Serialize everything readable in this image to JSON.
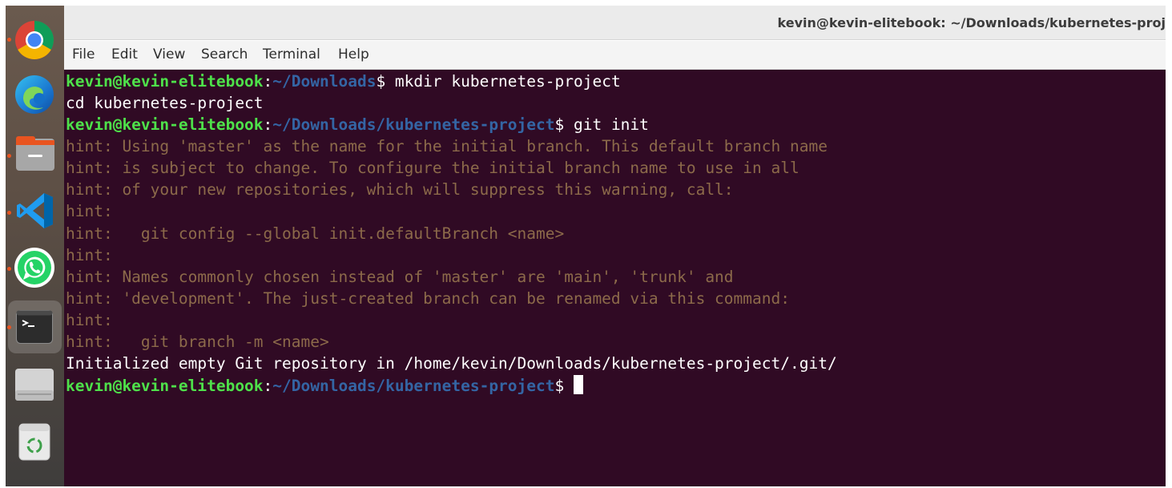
{
  "window": {
    "title": "kevin@kevin-elitebook: ~/Downloads/kubernetes-proj"
  },
  "menu": [
    "File",
    "Edit",
    "View",
    "Search",
    "Terminal",
    "Help"
  ],
  "dock": [
    {
      "name": "chrome",
      "running": true
    },
    {
      "name": "edge",
      "running": false
    },
    {
      "name": "files",
      "running": true
    },
    {
      "name": "vscode",
      "running": true
    },
    {
      "name": "whatsapp",
      "running": true
    },
    {
      "name": "terminal",
      "running": true,
      "active": true
    },
    {
      "name": "drive",
      "running": false
    },
    {
      "name": "trash",
      "running": false
    }
  ],
  "prompt": {
    "user_host": "kevin@kevin-elitebook",
    "colon": ":",
    "dollar": "$ "
  },
  "lines": [
    {
      "type": "prompt",
      "path": "~/Downloads",
      "cmd": "mkdir kubernetes-project"
    },
    {
      "type": "output",
      "text": "cd kubernetes-project"
    },
    {
      "type": "prompt",
      "path": "~/Downloads/kubernetes-project",
      "cmd": "git init"
    },
    {
      "type": "hint",
      "text": "hint: Using 'master' as the name for the initial branch. This default branch name"
    },
    {
      "type": "hint",
      "text": "hint: is subject to change. To configure the initial branch name to use in all"
    },
    {
      "type": "hint",
      "text": "hint: of your new repositories, which will suppress this warning, call:"
    },
    {
      "type": "hint",
      "text": "hint:"
    },
    {
      "type": "hint",
      "text": "hint:   git config --global init.defaultBranch <name>"
    },
    {
      "type": "hint",
      "text": "hint:"
    },
    {
      "type": "hint",
      "text": "hint: Names commonly chosen instead of 'master' are 'main', 'trunk' and"
    },
    {
      "type": "hint",
      "text": "hint: 'development'. The just-created branch can be renamed via this command:"
    },
    {
      "type": "hint",
      "text": "hint:"
    },
    {
      "type": "hint",
      "text": "hint:   git branch -m <name>"
    },
    {
      "type": "output",
      "text": "Initialized empty Git repository in /home/kevin/Downloads/kubernetes-project/.git/"
    },
    {
      "type": "prompt",
      "path": "~/Downloads/kubernetes-project",
      "cmd": ""
    }
  ],
  "colors": {
    "terminal_bg": "#300a24",
    "user": "#4ee14a",
    "path": "#3465a4",
    "hint": "#8c6a4a",
    "running_dot": "#e95420"
  }
}
